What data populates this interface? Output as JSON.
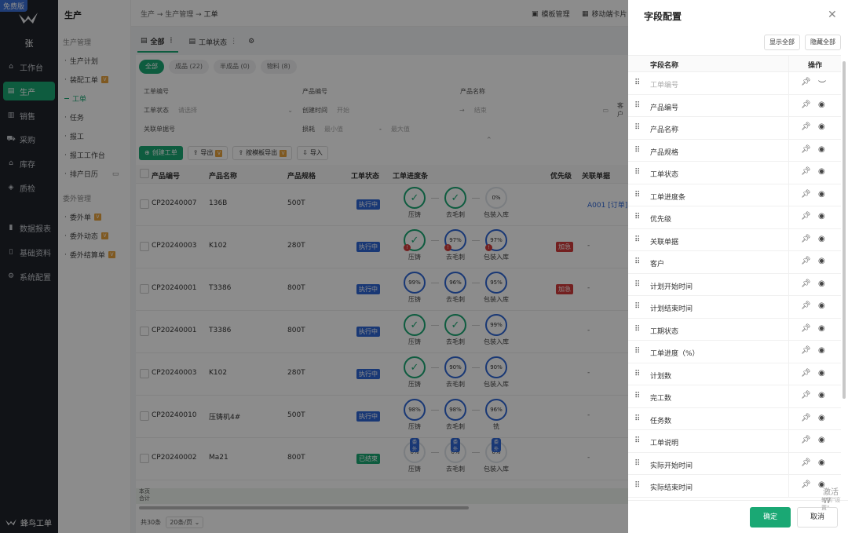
{
  "badge_free": "免费版",
  "user_initial": "张",
  "brand_name": "蜂鸟工单",
  "nav": [
    {
      "label": "工作台",
      "icon": "home-icon"
    },
    {
      "label": "生产",
      "icon": "production-icon",
      "active": true
    },
    {
      "label": "销售",
      "icon": "sales-icon"
    },
    {
      "label": "采购",
      "icon": "cart-icon"
    },
    {
      "label": "库存",
      "icon": "warehouse-icon"
    },
    {
      "label": "质检",
      "icon": "shield-icon"
    },
    {
      "label": "数据报表",
      "icon": "chart-icon"
    },
    {
      "label": "基础资料",
      "icon": "doc-icon"
    },
    {
      "label": "系统配置",
      "icon": "gear-icon"
    }
  ],
  "subnav": {
    "title": "生产",
    "group1": "生产管理",
    "group1_items": [
      "生产计划",
      "装配工单",
      "工单",
      "任务",
      "报工",
      "报工工作台",
      "排产日历"
    ],
    "group2": "委外管理",
    "group2_items": [
      "委外单",
      "委外动态",
      "委外结算单"
    ]
  },
  "breadcrumb": [
    "生产",
    "生产管理",
    "工单"
  ],
  "top_links": [
    "模板管理",
    "移动端卡片"
  ],
  "view_tabs": [
    "全部",
    "工单状态"
  ],
  "pills": [
    "全部",
    "成品 (22)",
    "半成品 (0)",
    "物料 (8)"
  ],
  "filters": {
    "order_no": "工单编号",
    "product_no": "产品编号",
    "product_name": "产品名称",
    "order_status": "工单状态",
    "order_status_ph": "请选择",
    "created_time": "创建时间",
    "created_ph": "开始",
    "end_ph": "结束",
    "customer": "客户",
    "related": "关联单据号",
    "loss": "损耗",
    "min_ph": "最小值",
    "max_ph": "最大值",
    "dash": "-"
  },
  "actions": [
    "创建工单",
    "导出",
    "按模板导出",
    "导入"
  ],
  "columns": [
    "产品编号",
    "产品名称",
    "产品规格",
    "工单状态",
    "工单进度条",
    "优先级",
    "关联单据"
  ],
  "rows": [
    {
      "no": "CP20240007",
      "name": "136B",
      "spec": "500T",
      "status": "执行中",
      "steps": [
        {
          "v": "✓",
          "l": "压铸",
          "t": "ok"
        },
        {
          "v": "✓",
          "l": "去毛刺",
          "t": "ok"
        },
        {
          "v": "0%",
          "l": "包装入库",
          "t": "light"
        }
      ],
      "prio": "",
      "link": "A001 [订单]"
    },
    {
      "no": "CP20240003",
      "name": "K102",
      "spec": "280T",
      "status": "执行中",
      "steps": [
        {
          "v": "✓",
          "l": "压铸",
          "t": "ok",
          "red": true
        },
        {
          "v": "97%",
          "l": "去毛刺",
          "red": true
        },
        {
          "v": "97%",
          "l": "包装入库",
          "red": true
        }
      ],
      "prio": "加急",
      "link": "-"
    },
    {
      "no": "CP20240001",
      "name": "T3386",
      "spec": "800T",
      "status": "执行中",
      "steps": [
        {
          "v": "99%",
          "l": "压铸"
        },
        {
          "v": "96%",
          "l": "去毛刺"
        },
        {
          "v": "95%",
          "l": "包装入库"
        }
      ],
      "prio": "加急",
      "link": "-"
    },
    {
      "no": "CP20240001",
      "name": "T3386",
      "spec": "800T",
      "status": "执行中",
      "steps": [
        {
          "v": "✓",
          "l": "压铸",
          "t": "ok"
        },
        {
          "v": "✓",
          "l": "去毛刺",
          "t": "ok"
        },
        {
          "v": "99%",
          "l": "包装入库"
        }
      ],
      "prio": "",
      "link": "-"
    },
    {
      "no": "CP20240003",
      "name": "K102",
      "spec": "280T",
      "status": "执行中",
      "steps": [
        {
          "v": "✓",
          "l": "压铸",
          "t": "ok"
        },
        {
          "v": "90%",
          "l": "去毛刺"
        },
        {
          "v": "90%",
          "l": "包装入库"
        }
      ],
      "prio": "",
      "link": "-"
    },
    {
      "no": "CP20240010",
      "name": "压铸机4#",
      "spec": "500T",
      "status": "执行中",
      "steps": [
        {
          "v": "98%",
          "l": "压铸"
        },
        {
          "v": "98%",
          "l": "去毛刺"
        },
        {
          "v": "96%",
          "l": "铣"
        }
      ],
      "prio": "",
      "link": "-"
    },
    {
      "no": "CP20240002",
      "name": "Ma21",
      "spec": "800T",
      "status": "已结束",
      "steps": [
        {
          "v": "0%",
          "l": "压铸",
          "t": "light",
          "ext": "委外"
        },
        {
          "v": "0%",
          "l": "去毛刺",
          "t": "light",
          "ext": "委外"
        },
        {
          "v": "0%",
          "l": "包装入库",
          "t": "light",
          "ext": "委外"
        }
      ],
      "prio": "",
      "link": "-"
    }
  ],
  "summary": [
    "本页",
    "合计"
  ],
  "pager": {
    "total": "共30条",
    "size": "20条/页"
  },
  "drawer": {
    "title": "字段配置",
    "show_all": "显示全部",
    "hide_all": "隐藏全部",
    "col_name": "字段名称",
    "col_op": "操作",
    "fields": [
      "工单编号",
      "产品编号",
      "产品名称",
      "产品规格",
      "工单状态",
      "工单进度条",
      "优先级",
      "关联单据",
      "客户",
      "计划开始时间",
      "计划结束时间",
      "工期状态",
      "工单进度（%）",
      "计划数",
      "完工数",
      "任务数",
      "工单说明",
      "实际开始时间",
      "实际结束时间"
    ],
    "confirm": "确定",
    "cancel": "取消"
  },
  "watermark": "激活 W",
  "watermark2": "转到\"设置\""
}
